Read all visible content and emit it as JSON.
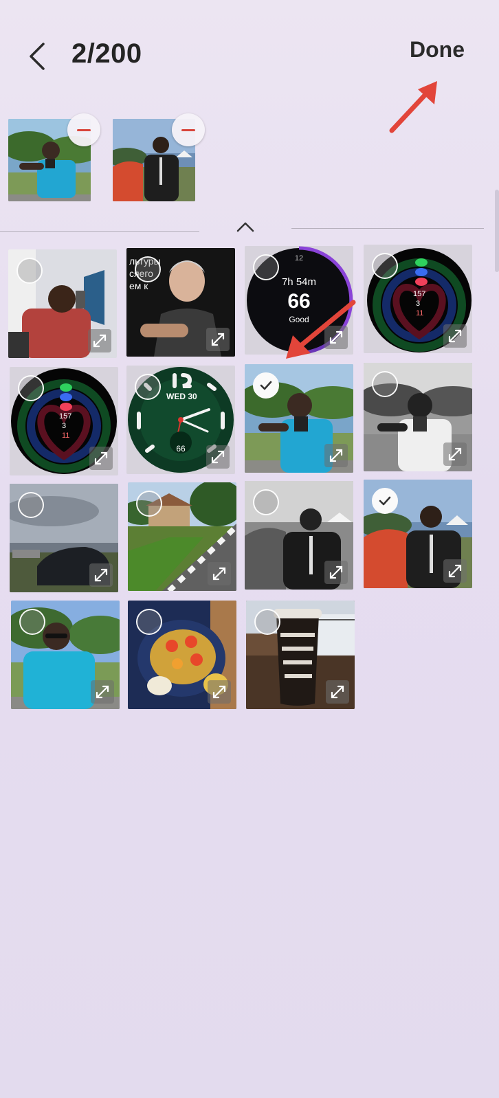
{
  "header": {
    "counter": "2/200",
    "done_label": "Done"
  },
  "selected": [
    {
      "name": "selected-photo-1",
      "subject": "man-blue-shirt-camera"
    },
    {
      "name": "selected-photo-2",
      "subject": "man-black-jacket"
    }
  ],
  "watch": {
    "sleep": {
      "top": "12",
      "time": "7h 54m",
      "score": "66",
      "label": "Good"
    },
    "activity": {
      "steps": "157",
      "exercise": "3",
      "calories": "11"
    },
    "analog": {
      "date": "WED 30",
      "heart": "66"
    }
  },
  "news": {
    "lines": [
      "льтуры",
      "",
      "сяего",
      "ем к"
    ]
  },
  "icons": {
    "back": "chevron-left-icon",
    "collapse": "chevron-up-icon",
    "remove": "minus-icon",
    "check": "checkmark-icon",
    "expand": "expand-icon"
  },
  "colors": {
    "accent_red": "#e2453a",
    "background": "#e8e0f0"
  }
}
